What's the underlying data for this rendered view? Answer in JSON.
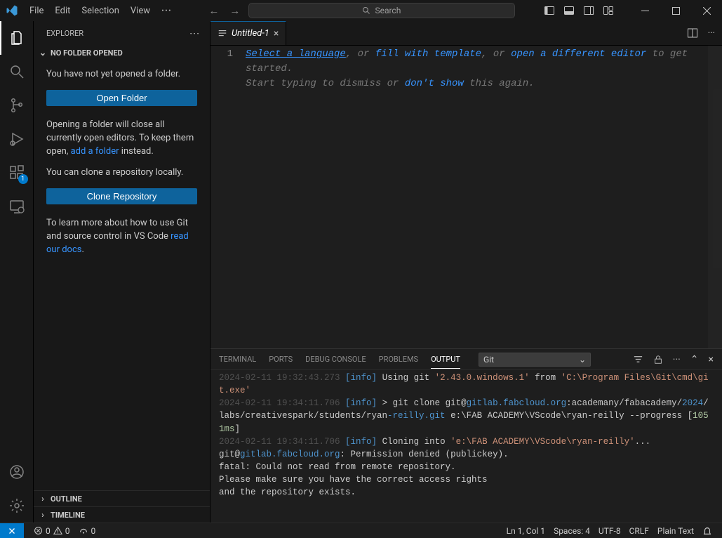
{
  "menubar": {
    "items": [
      "File",
      "Edit",
      "Selection",
      "View"
    ],
    "overflow": "···"
  },
  "titlebar": {
    "search_placeholder": "Search"
  },
  "activitybar": {
    "extensions_badge": "1"
  },
  "sidebar": {
    "title": "EXPLORER",
    "section_title": "NO FOLDER OPENED",
    "no_folder_text": "You have not yet opened a folder.",
    "open_folder_label": "Open Folder",
    "close_editors_text_pre": "Opening a folder will close all currently open editors. To keep them open, ",
    "close_editors_link": "add a folder",
    "close_editors_text_post": " instead.",
    "clone_text": "You can clone a repository locally.",
    "clone_button_label": "Clone Repository",
    "docs_text_pre": "To learn more about how to use Git and source control in VS Code ",
    "docs_link": "read our docs",
    "docs_text_post": ".",
    "outline_label": "OUTLINE",
    "timeline_label": "TIMELINE"
  },
  "editor": {
    "tab_label": "Untitled-1",
    "line_number": "1",
    "placeholder": {
      "select_language": "Select a language",
      "sep1": ", or ",
      "fill_template": "fill with template",
      "sep2": ", or ",
      "open_editor": "open a different editor",
      "tail1": " to get started.",
      "line2_pre": "Start typing to dismiss or ",
      "dont_show": "don't show",
      "line2_post": " this again."
    }
  },
  "panel": {
    "tabs": {
      "terminal": "TERMINAL",
      "ports": "PORTS",
      "debug_console": "DEBUG CONSOLE",
      "problems": "PROBLEMS",
      "output": "OUTPUT"
    },
    "filter_value": "Git",
    "output": [
      {
        "ts": "2024-02-11 19:32:43.273",
        "lvl": "[info]",
        "pre": " Using git ",
        "str": "'2.43.0.windows.1'",
        "mid": " from ",
        "str2": "'C:\\Program Files\\Git\\cmd\\git.exe'"
      },
      {
        "ts": "2024-02-11 19:34:11.706",
        "lvl": "[info]",
        "text": " > git clone git@",
        "host": "gitlab.fabcloud.org",
        "rest": ":academany/fabacademy/",
        "cont": "2024",
        "rest2": "/labs/creativespark/students/ryan",
        "dash": "-reilly.git",
        "tail": " e:\\FAB ACADEMY\\VScode\\ryan-reilly --progress [",
        "ms": "1051ms",
        "tail2": "]"
      },
      {
        "ts": "2024-02-11 19:34:11.706",
        "lvl": "[info]",
        "text": " Cloning into ",
        "str": "'e:\\FAB ACADEMY\\VScode\\ryan-reilly'",
        "tail": "..."
      },
      {
        "plain_pre": "git@",
        "host": "gitlab.fabcloud.org",
        "plain_post": ": Permission denied (publickey)."
      },
      {
        "plain": "fatal: Could not read from remote repository."
      },
      {
        "plain": ""
      },
      {
        "plain": "Please make sure you have the correct access rights"
      },
      {
        "plain": "and the repository exists."
      }
    ]
  },
  "statusbar": {
    "errors": "0",
    "warnings": "0",
    "ports": "0",
    "cursor": "Ln 1, Col 1",
    "spaces": "Spaces: 4",
    "encoding": "UTF-8",
    "eol": "CRLF",
    "language": "Plain Text"
  }
}
